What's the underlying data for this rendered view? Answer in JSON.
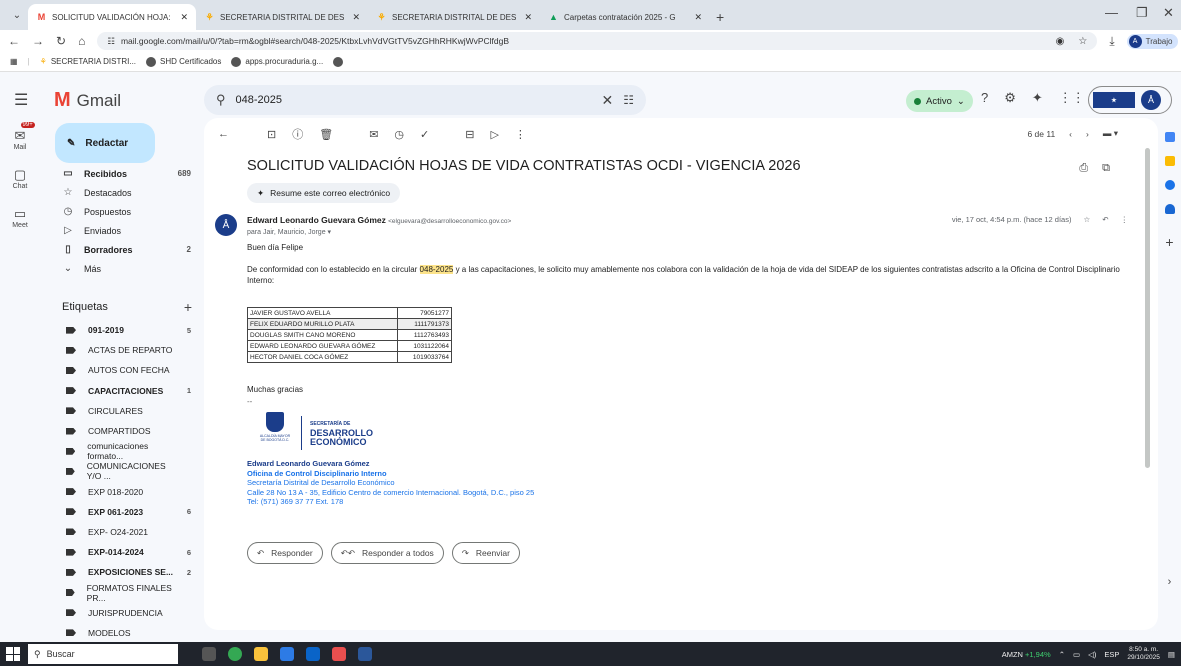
{
  "browser": {
    "tabs": [
      {
        "title": "SOLICITUD VALIDACIÓN HOJA:",
        "active": true
      },
      {
        "title": "SECRETARIA DISTRITAL DE DES",
        "active": false
      },
      {
        "title": "SECRETARIA DISTRITAL DE DES",
        "active": false
      },
      {
        "title": "Carpetas contratación 2025 - G",
        "active": false
      }
    ],
    "url": "mail.google.com/mail/u/0/?tab=rm&ogbl#search/048-2025/KtbxLvhVdVGtTV5vZGHhRHKwjWvPClfdgB",
    "profile_label": "Trabajo",
    "bookmarks": [
      "SECRETARIA DISTRI...",
      "SHD Certificados",
      "apps.procuraduria.g..."
    ]
  },
  "gmail": {
    "app_name": "Gmail",
    "search_query": "048-2025",
    "status": "Activo",
    "compose_label": "Redactar",
    "rail": [
      {
        "label": "Mail",
        "badge": "99+"
      },
      {
        "label": "Chat"
      },
      {
        "label": "Meet"
      }
    ],
    "nav": [
      {
        "label": "Recibidos",
        "count": "689",
        "bold": true,
        "icon": "inbox-icon",
        "glyph": "▭"
      },
      {
        "label": "Destacados",
        "count": "",
        "bold": false,
        "icon": "star-icon",
        "glyph": "☆"
      },
      {
        "label": "Pospuestos",
        "count": "",
        "bold": false,
        "icon": "clock-icon",
        "glyph": "◷"
      },
      {
        "label": "Enviados",
        "count": "",
        "bold": false,
        "icon": "send-icon",
        "glyph": "▷"
      },
      {
        "label": "Borradores",
        "count": "2",
        "bold": true,
        "icon": "draft-icon",
        "glyph": "▯"
      },
      {
        "label": "Más",
        "count": "",
        "bold": false,
        "icon": "chevron-down-icon",
        "glyph": "⌄"
      }
    ],
    "labels_heading": "Etiquetas",
    "labels": [
      {
        "label": "091-2019",
        "count": "5",
        "bold": true
      },
      {
        "label": "ACTAS DE REPARTO",
        "count": "",
        "bold": false
      },
      {
        "label": "AUTOS CON FECHA",
        "count": "",
        "bold": false
      },
      {
        "label": "CAPACITACIONES",
        "count": "1",
        "bold": true
      },
      {
        "label": "CIRCULARES",
        "count": "",
        "bold": false
      },
      {
        "label": "COMPARTIDOS",
        "count": "",
        "bold": false
      },
      {
        "label": "comunicaciones formato...",
        "count": "",
        "bold": false
      },
      {
        "label": "COMUNICACIONES Y/O ...",
        "count": "",
        "bold": false
      },
      {
        "label": "EXP 018-2020",
        "count": "",
        "bold": false
      },
      {
        "label": "EXP 061-2023",
        "count": "6",
        "bold": true
      },
      {
        "label": "EXP- O24-2021",
        "count": "",
        "bold": false
      },
      {
        "label": "EXP-014-2024",
        "count": "6",
        "bold": true
      },
      {
        "label": "EXPOSICIONES SE...",
        "count": "2",
        "bold": true
      },
      {
        "label": "FORMATOS FINALES PR...",
        "count": "",
        "bold": false
      },
      {
        "label": "JURISPRUDENCIA",
        "count": "",
        "bold": false
      },
      {
        "label": "MODELOS",
        "count": "",
        "bold": false
      }
    ],
    "pager": "6 de 11",
    "email": {
      "subject": "SOLICITUD VALIDACIÓN HOJAS DE VIDA CONTRATISTAS OCDI - VIGENCIA 2026",
      "summarize": "Resume este correo electrónico",
      "sender_name": "Edward Leonardo Guevara Gómez",
      "sender_email": "<elguevara@desarrolloeconomico.gov.co>",
      "recipients": "para Jair, Mauricio, Jorge",
      "date": "vie, 17 oct, 4:54 p.m. (hace 12 días)",
      "greeting": "Buen día Felipe",
      "body_before": "De conformidad con lo establecido en la circular ",
      "body_highlight": "048-2025",
      "body_after": " y a las capacitaciones, le solicito muy amablemente nos colabora con la validación de la hoja de vida del SIDEAP de los siguientes contratistas adscrito a la Oficina de Control Disciplinario Interno:",
      "contractors": [
        {
          "name": "JAVIER GUSTAVO AVELLA",
          "id": "79051277"
        },
        {
          "name": "FELIX EDUARDO MURILLO PLATA",
          "id": "1111791373"
        },
        {
          "name": "DOUGLAS SMITH CANO MORENO",
          "id": "1112763493"
        },
        {
          "name": "EDWARD LEONARDO GUEVARA GÓMEZ",
          "id": "1031122064"
        },
        {
          "name": "HECTOR DANIEL COCA GÓMEZ",
          "id": "1019033764"
        }
      ],
      "closing": "Muchas gracias",
      "separator": "--",
      "logo": {
        "crest_text": "ALCALDÍA MAYOR DE BOGOTÁ D.C.",
        "line1": "SECRETARÍA DE",
        "line2": "DESARROLLO",
        "line3": "ECONÓMICO"
      },
      "signature": {
        "name": "Edward Leonardo Guevara Gómez",
        "office": "Oficina de Control Disciplinario Interno",
        "entity": "Secretaría Distrital de Desarrollo Económico",
        "address": "Calle 28 No 13 A - 35, Edificio Centro de comercio Internacional. Bogotá, D.C., piso 25",
        "phone": "Tel: (571) 369 37 77 Ext. 178"
      },
      "actions": {
        "reply": "Responder",
        "reply_all": "Responder a todos",
        "forward": "Reenviar"
      }
    }
  },
  "taskbar": {
    "search_placeholder": "Buscar",
    "ticker": "AMZN",
    "ticker_change": "+1,94%",
    "lang": "ESP",
    "time": "8:50 a. m.",
    "date": "29/10/2025"
  },
  "colors": {
    "accent": "#1a73e8",
    "compose_bg": "#c2e7ff",
    "highlight": "#fce38a",
    "brand_blue": "#1b3d8a"
  }
}
